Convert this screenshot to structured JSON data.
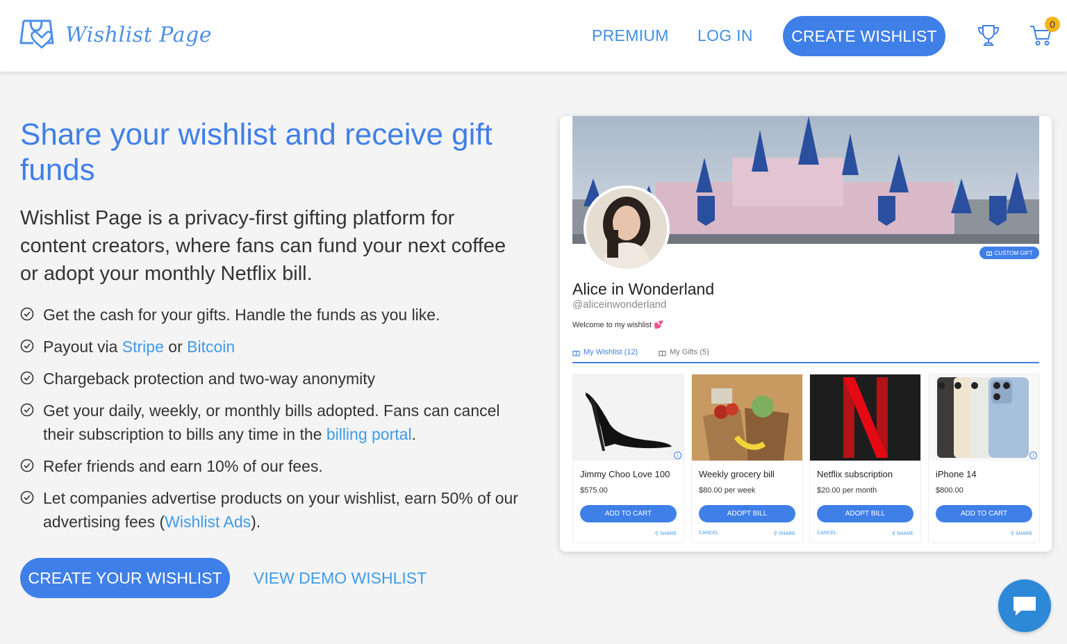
{
  "header": {
    "logo_text": "Wishlist Page",
    "nav": {
      "premium": "PREMIUM",
      "login": "LOG IN"
    },
    "create_button": "CREATE WISHLIST",
    "cart_count": "0"
  },
  "hero": {
    "headline": "Share your wishlist and receive gift funds",
    "intro": "Wishlist Page is a privacy-first gifting platform for content creators, where fans can fund your next coffee or adopt your monthly Netflix bill.",
    "features": {
      "f1": "Get the cash for your gifts. Handle the funds as you like.",
      "f2_pre": "Payout via ",
      "f2_link1": "Stripe",
      "f2_mid": " or ",
      "f2_link2": "Bitcoin",
      "f3": "Chargeback protection and two-way anonymity",
      "f4_pre": "Get your daily, weekly, or monthly bills adopted. Fans can cancel their subscription to bills any time in the ",
      "f4_link": "billing portal",
      "f4_post": ".",
      "f5": "Refer friends and earn 10% of our fees.",
      "f6_pre": "Let companies advertise products on your wishlist, earn 50% of our advertising fees (",
      "f6_link": "Wishlist Ads",
      "f6_post": ")."
    },
    "cta_primary": "CREATE YOUR WISHLIST",
    "cta_secondary": "VIEW DEMO WISHLIST"
  },
  "preview": {
    "custom_gift": "CUSTOM GIFT",
    "name": "Alice in Wonderland",
    "handle": "@aliceinwonderland",
    "welcome": "Welcome to my wishlist 💕",
    "tabs": {
      "wishlist": "My Wishlist (12)",
      "gifts": "My Gifts (5)"
    },
    "items": [
      {
        "title": "Jimmy Choo Love 100",
        "price": "$575.00",
        "button": "ADD TO CART",
        "cancel": "",
        "share": "SHARE"
      },
      {
        "title": "Weekly grocery bill",
        "price": "$80.00 per week",
        "button": "ADOPT BILL",
        "cancel": "CANCEL",
        "share": "SHARE"
      },
      {
        "title": "Netflix subscription",
        "price": "$20.00 per month",
        "button": "ADOPT BILL",
        "cancel": "CANCEL",
        "share": "SHARE"
      },
      {
        "title": "iPhone 14",
        "price": "$800.00",
        "button": "ADD TO CART",
        "cancel": "",
        "share": "SHARE"
      }
    ]
  },
  "colors": {
    "accent": "#3f7fe8",
    "link": "#3f9be8",
    "badge": "#f2b61c",
    "chat": "#2e88d8"
  },
  "icons": [
    "logo-bag-heart-icon",
    "trophy-icon",
    "cart-icon",
    "check-circle-icon",
    "gift-icon",
    "chat-icon",
    "info-icon",
    "link-icon"
  ]
}
